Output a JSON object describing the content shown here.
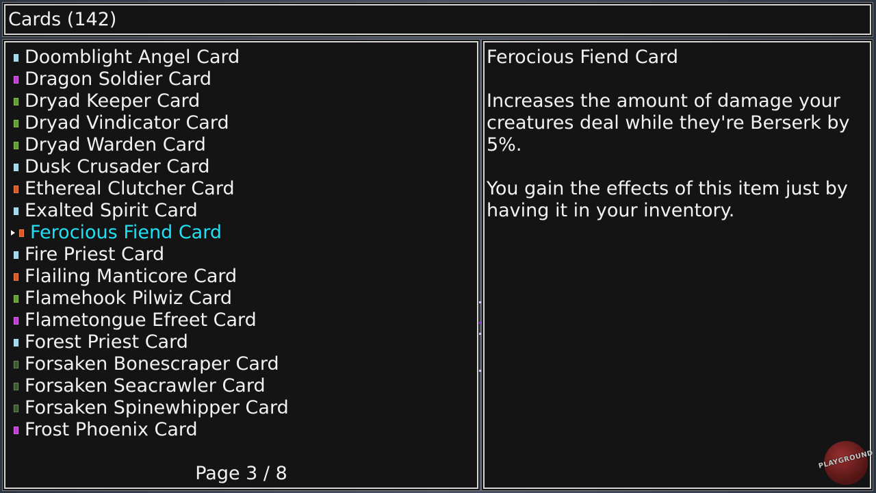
{
  "header": {
    "title": "Cards (142)"
  },
  "list": {
    "items": [
      {
        "label": "Doomblight Angel Card",
        "color": "#9fd8ee",
        "selected": false
      },
      {
        "label": "Dragon Soldier Card",
        "color": "#c23ad8",
        "selected": false
      },
      {
        "label": "Dryad Keeper Card",
        "color": "#5fa02c",
        "selected": false
      },
      {
        "label": "Dryad Vindicator Card",
        "color": "#5fa02c",
        "selected": false
      },
      {
        "label": "Dryad Warden Card",
        "color": "#5fa02c",
        "selected": false
      },
      {
        "label": "Dusk Crusader Card",
        "color": "#9fd8ee",
        "selected": false
      },
      {
        "label": "Ethereal Clutcher Card",
        "color": "#e0561c",
        "selected": false
      },
      {
        "label": "Exalted Spirit Card",
        "color": "#9fd8ee",
        "selected": false
      },
      {
        "label": "Ferocious Fiend Card",
        "color": "#e0561c",
        "selected": true
      },
      {
        "label": "Fire Priest Card",
        "color": "#9fd8ee",
        "selected": false
      },
      {
        "label": "Flailing Manticore Card",
        "color": "#e0561c",
        "selected": false
      },
      {
        "label": "Flamehook Pilwiz Card",
        "color": "#5fa02c",
        "selected": false
      },
      {
        "label": "Flametongue Efreet Card",
        "color": "#c23ad8",
        "selected": false
      },
      {
        "label": "Forest Priest Card",
        "color": "#9fd8ee",
        "selected": false
      },
      {
        "label": "Forsaken Bonescraper Card",
        "color": "#3a5a2a",
        "selected": false
      },
      {
        "label": "Forsaken Seacrawler Card",
        "color": "#3a5a2a",
        "selected": false
      },
      {
        "label": "Forsaken Spinewhipper Card",
        "color": "#3a5a2a",
        "selected": false
      },
      {
        "label": "Frost Phoenix Card",
        "color": "#c23ad8",
        "selected": false
      }
    ],
    "pager": "Page 3 / 8"
  },
  "detail": {
    "title": "Ferocious Fiend Card",
    "description": "Increases the amount of damage your creatures deal while they're Berserk by 5%.",
    "note": "You gain the effects of this item just by having it in your inventory."
  },
  "watermark": {
    "text": "PLAYGROUND"
  },
  "colors": {
    "panel_bg": "#141414",
    "border": "#d6d6d6",
    "text": "#f2f2f2",
    "selected_text": "#1fe0f5"
  }
}
